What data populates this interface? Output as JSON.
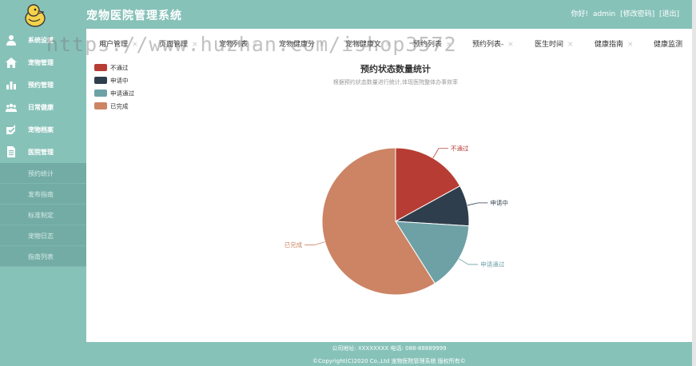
{
  "header": {
    "app_title": "宠物医院管理系统",
    "greeting": "你好!",
    "username": "admin",
    "change_password": "[修改密码]",
    "logout": "[退出]"
  },
  "sidebar": {
    "items": [
      {
        "label": "系统设置",
        "icon": "user-icon"
      },
      {
        "label": "宠物管理",
        "icon": "home-icon"
      },
      {
        "label": "预约管理",
        "icon": "bar-chart-icon"
      },
      {
        "label": "日常健康",
        "icon": "users-icon"
      },
      {
        "label": "宠物档案",
        "icon": "check-icon"
      },
      {
        "label": "医院管理",
        "icon": "document-icon"
      }
    ],
    "subitems": [
      {
        "label": "预约统计"
      },
      {
        "label": "发布指南"
      },
      {
        "label": "标准制定"
      },
      {
        "label": "宠物日志"
      },
      {
        "label": "指南列表"
      }
    ]
  },
  "tabs": [
    {
      "label": "用户管理"
    },
    {
      "label": "页面管理"
    },
    {
      "label": "宠物列表"
    },
    {
      "label": "宠物健康分"
    },
    {
      "label": "宠物健康文"
    },
    {
      "label": "预约列表"
    },
    {
      "label": "预约列表-"
    },
    {
      "label": "医生时间"
    },
    {
      "label": "健康指南"
    },
    {
      "label": "健康监测"
    }
  ],
  "watermark": "https://www.huzhan.com/ishop3572",
  "chart_data": {
    "type": "pie",
    "title": "预约状态数量统计",
    "subtitle": "根据预约状态数量进行统计,体现医院整体办事效率",
    "legend_position": "top-left",
    "categories": [
      "不通过",
      "申请中",
      "申请通过",
      "已完成"
    ],
    "values": [
      17,
      9,
      15,
      59
    ],
    "colors": [
      "#b73d34",
      "#2f3e4c",
      "#6ea1a6",
      "#cc8464"
    ]
  },
  "footer": {
    "address": "公司地址: XXXXXXXX 电话: 088-88889999",
    "copyright": "©Copyright(C)2020 Co.,Ltd 宠物医院管理系统 版权所有©"
  },
  "colors": {
    "theme": "#87c2b9",
    "submenu": "#73aca5"
  }
}
